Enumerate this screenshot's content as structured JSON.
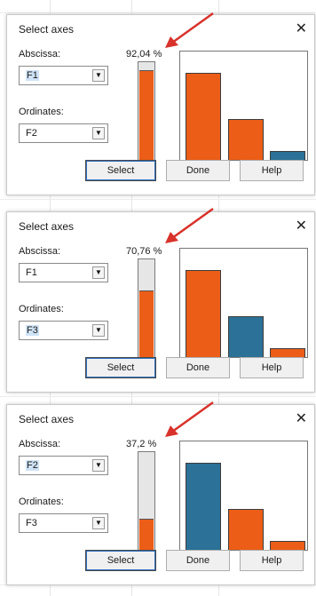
{
  "colors": {
    "orange": "#EC5D17",
    "blue": "#2C7197",
    "gauge_empty": "#E6E6E6",
    "arrow": "#D8322A"
  },
  "icons": {
    "close": "close-icon",
    "dropdown": "chevron-down-icon",
    "pointer": "red-arrow"
  },
  "dialogs": [
    {
      "title": "Select axes",
      "abscissa_label": "Abscissa:",
      "abscissa_value": "F1",
      "ordinates_label": "Ordinates:",
      "ordinates_value": "F2",
      "percentage_text": "92,04 %",
      "percentage": 92.04,
      "bars": [
        {
          "value": 0.82,
          "color": "orange"
        },
        {
          "value": 0.38,
          "color": "orange"
        },
        {
          "value": 0.08,
          "color": "blue"
        }
      ],
      "buttons": {
        "select": "Select",
        "done": "Done",
        "help": "Help"
      }
    },
    {
      "title": "Select axes",
      "abscissa_label": "Abscissa:",
      "abscissa_value": "F1",
      "ordinates_label": "Ordinates:",
      "ordinates_value": "F3",
      "percentage_text": "70,76 %",
      "percentage": 70.76,
      "bars": [
        {
          "value": 0.82,
          "color": "orange"
        },
        {
          "value": 0.38,
          "color": "blue"
        },
        {
          "value": 0.08,
          "color": "orange"
        }
      ],
      "buttons": {
        "select": "Select",
        "done": "Done",
        "help": "Help"
      }
    },
    {
      "title": "Select axes",
      "abscissa_label": "Abscissa:",
      "abscissa_value": "F2",
      "ordinates_label": "Ordinates:",
      "ordinates_value": "F3",
      "percentage_text": "37,2 %",
      "percentage": 37.2,
      "bars": [
        {
          "value": 0.82,
          "color": "blue"
        },
        {
          "value": 0.38,
          "color": "orange"
        },
        {
          "value": 0.08,
          "color": "orange"
        }
      ],
      "buttons": {
        "select": "Select",
        "done": "Done",
        "help": "Help"
      }
    }
  ]
}
